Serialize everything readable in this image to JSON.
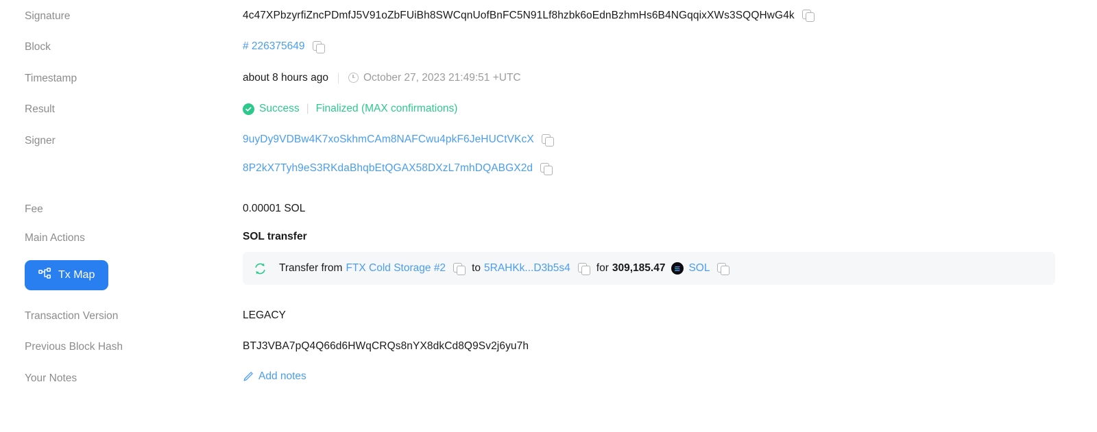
{
  "colors": {
    "link": "#4a9df0",
    "success": "#2dc98c",
    "button": "#2a7ff0",
    "label": "#8c8c8c",
    "card_bg": "#f6f7f9"
  },
  "rows": {
    "signature": {
      "label": "Signature",
      "value": "4c47XPbzyrfiZncPDmfJ5V91oZbFUiBh8SWCqnUofBnFC5N91Lf8hzbk6oEdnBzhmHs6B4NGqqixXWs3SQQHwG4k"
    },
    "block": {
      "label": "Block",
      "value": "# 226375649"
    },
    "timestamp": {
      "label": "Timestamp",
      "relative": "about 8 hours ago",
      "absolute": "October 27, 2023 21:49:51 +UTC"
    },
    "result": {
      "label": "Result",
      "status": "Success",
      "confirmations": "Finalized (MAX confirmations)"
    },
    "signer": {
      "label": "Signer",
      "addresses": [
        "9uyDy9VDBw4K7xoSkhmCAm8NAFCwu4pkF6JeHUCtVKcX",
        "8P2kX7Tyh9eS3RKdaBhqbEtQGAX58DXzL7mhDQABGX2d"
      ]
    },
    "fee": {
      "label": "Fee",
      "value": "0.00001 SOL"
    },
    "main_actions": {
      "label": "Main Actions",
      "button_label": "Tx Map",
      "action_title": "SOL transfer",
      "transfer": {
        "prefix": "Transfer from",
        "from": "FTX Cold Storage #2",
        "mid": "to",
        "to": "5RAHKk...D3b5s4",
        "for_label": "for",
        "amount": "309,185.47",
        "token": "SOL"
      }
    },
    "transaction_version": {
      "label": "Transaction Version",
      "value": "LEGACY"
    },
    "previous_block_hash": {
      "label": "Previous Block Hash",
      "value": "BTJ3VBA7pQ4Q66d6HWqCRQs8nYX8dkCd8Q9Sv2j6yu7h"
    },
    "your_notes": {
      "label": "Your Notes",
      "action": "Add notes"
    }
  }
}
